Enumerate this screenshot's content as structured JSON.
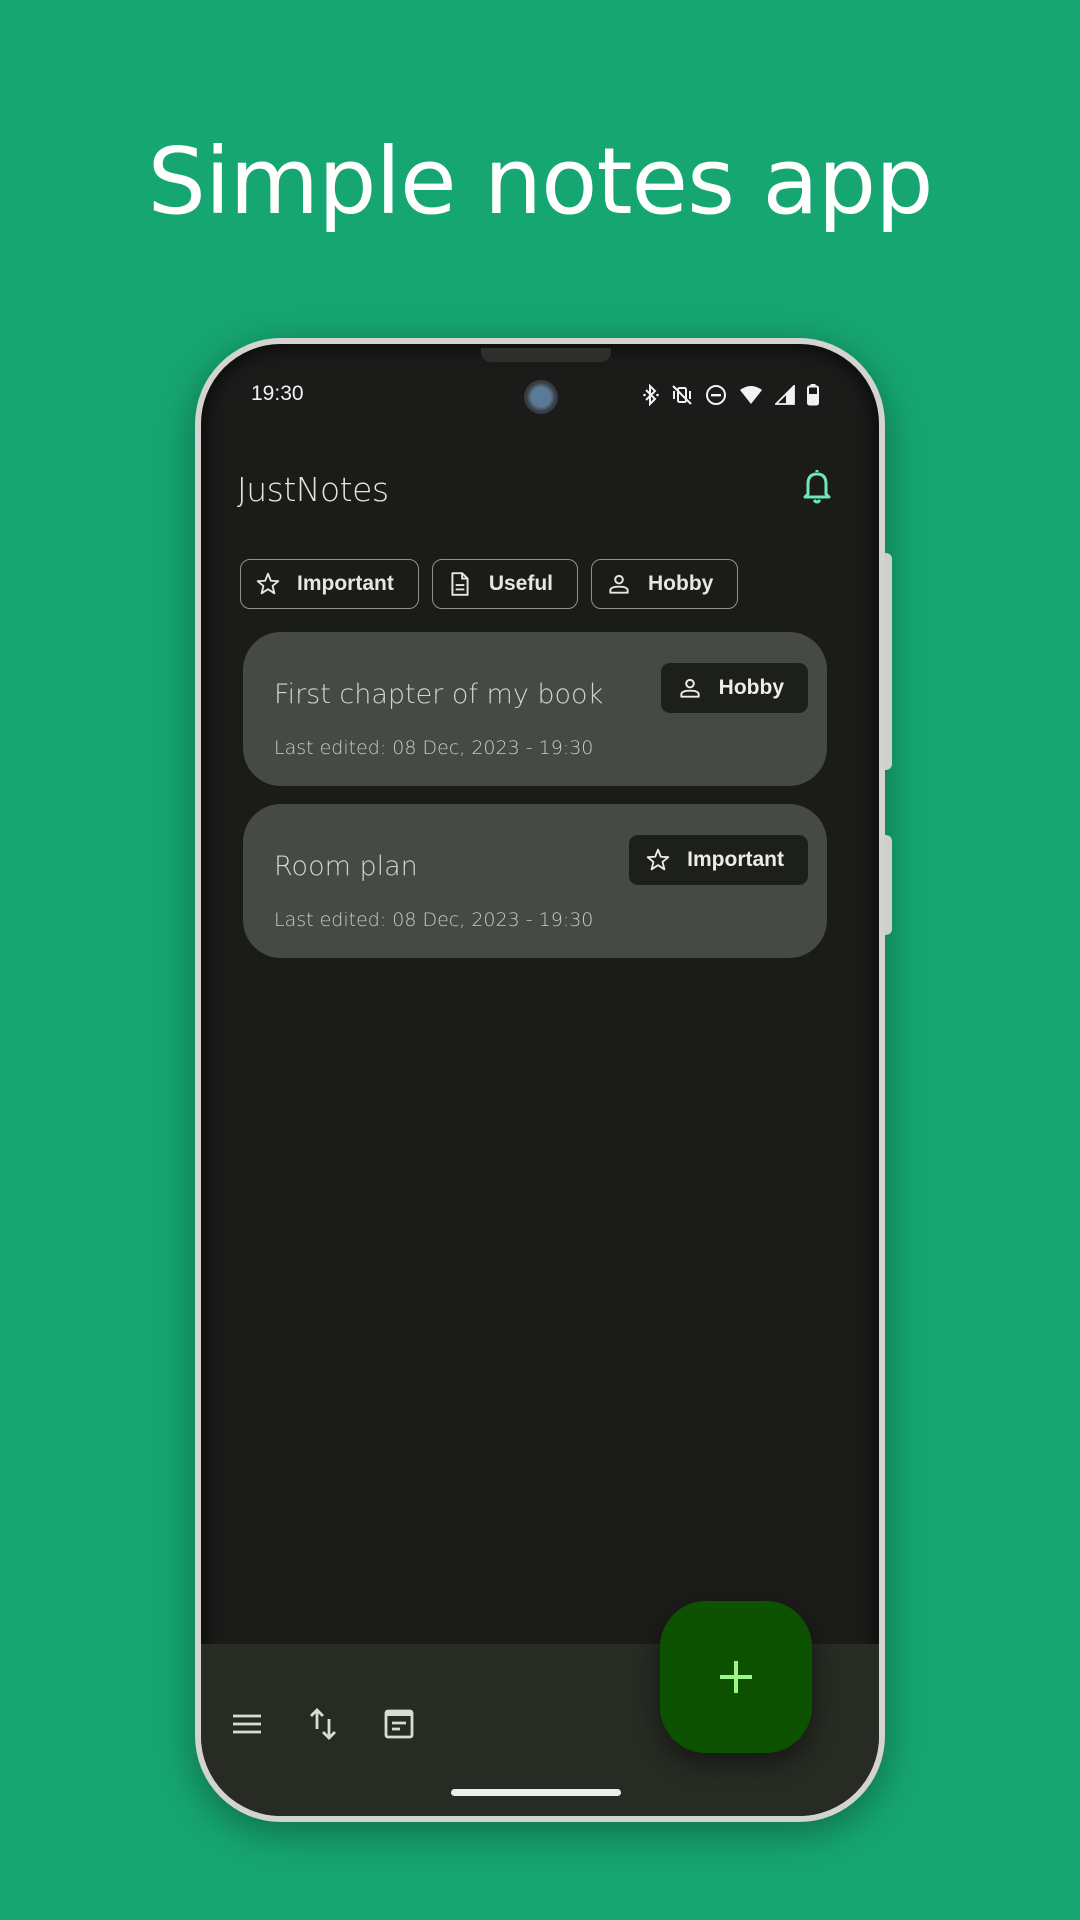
{
  "promo": {
    "title": "Simple notes app"
  },
  "status_bar": {
    "time": "19:30",
    "icons": [
      "bluetooth-icon",
      "vibrate-off-icon",
      "do-not-disturb-icon",
      "wifi-icon",
      "signal-icon",
      "battery-icon"
    ]
  },
  "app": {
    "title": "JustNotes",
    "bell_icon": "bell-icon",
    "accent": "#6ee7b7"
  },
  "filters": [
    {
      "label": "Important",
      "icon": "star-icon"
    },
    {
      "label": "Useful",
      "icon": "document-icon"
    },
    {
      "label": "Hobby",
      "icon": "person-icon"
    }
  ],
  "notes": [
    {
      "title": "First chapter of my book",
      "last_edited": "Last edited: 08 Dec, 2023 - 19:30",
      "tag": "Hobby",
      "tag_icon": "person-icon"
    },
    {
      "title": "Room plan",
      "last_edited": "Last edited: 08 Dec, 2023 - 19:30",
      "tag": "Important",
      "tag_icon": "star-icon"
    }
  ],
  "bottom_bar": {
    "items": [
      {
        "name": "menu",
        "icon": "menu-icon"
      },
      {
        "name": "sort",
        "icon": "sort-icon"
      },
      {
        "name": "notes-view",
        "icon": "note-view-icon"
      }
    ],
    "fab": {
      "icon": "plus-icon",
      "color": "#0d5200",
      "icon_color": "#9ef58a"
    }
  },
  "colors": {
    "background": "#16a672",
    "screen": "#1b1c1a",
    "card": "#464a44",
    "bottom_bar": "#272b23"
  }
}
